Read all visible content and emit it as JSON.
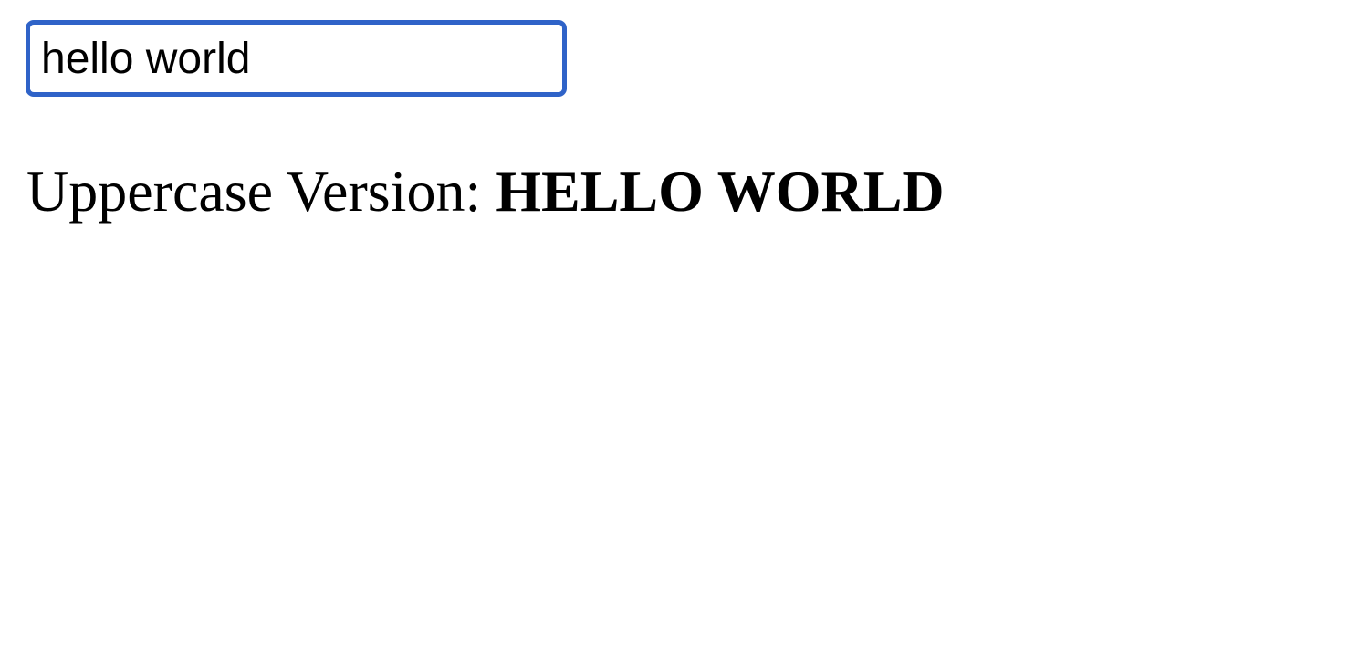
{
  "input": {
    "value": "hello world"
  },
  "output": {
    "label": "Uppercase Version: ",
    "value": "HELLO WORLD"
  },
  "colors": {
    "focus_border": "#2f63c8"
  }
}
